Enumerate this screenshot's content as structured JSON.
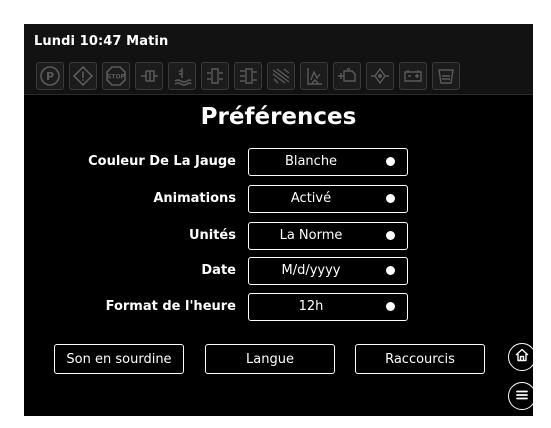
{
  "status": {
    "datetime": "Lundi 10:47 Matin"
  },
  "telltales": [
    {
      "name": "parking-brake-icon"
    },
    {
      "name": "warning-triangle-icon"
    },
    {
      "name": "stop-icon",
      "text": "STOP"
    },
    {
      "name": "glow-plug-icon"
    },
    {
      "name": "coolant-temp-icon"
    },
    {
      "name": "fuel-filter-icon"
    },
    {
      "name": "water-in-fuel-icon"
    },
    {
      "name": "dpf-icon"
    },
    {
      "name": "regen-icon"
    },
    {
      "name": "engine-check-icon"
    },
    {
      "name": "oil-pressure-icon"
    },
    {
      "name": "battery-icon"
    },
    {
      "name": "air-filter-icon"
    }
  ],
  "page": {
    "title": "Préférences"
  },
  "settings": [
    {
      "label": "Couleur De La Jauge",
      "value": "Blanche"
    },
    {
      "label": "Animations",
      "value": "Activé"
    },
    {
      "label": "Unités",
      "value": "La Norme"
    },
    {
      "label": "Date",
      "value": "M/d/yyyy"
    },
    {
      "label": "Format de l'heure",
      "value": "12h"
    }
  ],
  "actions": {
    "mute": "Son en sourdine",
    "language": "Langue",
    "shortcuts": "Raccourcis"
  },
  "nav": {
    "home_icon": "home-icon",
    "menu_icon": "menu-icon"
  },
  "colors": {
    "background": "#000000",
    "foreground": "#ffffff",
    "icon_dim": "#5a5a5a"
  }
}
